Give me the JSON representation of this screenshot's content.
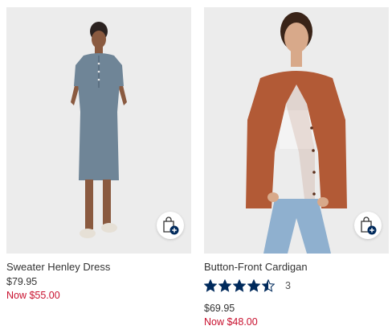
{
  "products": [
    {
      "name": "Sweater Henley Dress",
      "price_original": "$79.95",
      "price_sale": "Now $55.00",
      "bag_icon": "shopping-bag-add-icon"
    },
    {
      "name": "Button-Front Cardigan",
      "rating": 4.5,
      "rating_max": 5,
      "review_count": "3",
      "price_original": "$69.95",
      "price_sale": "Now $48.00",
      "bag_icon": "shopping-bag-add-icon"
    }
  ],
  "colors": {
    "sale_price": "#c8102e",
    "star": "#002a5c",
    "bag_badge": "#002a5c",
    "image_background": "#ececec"
  }
}
